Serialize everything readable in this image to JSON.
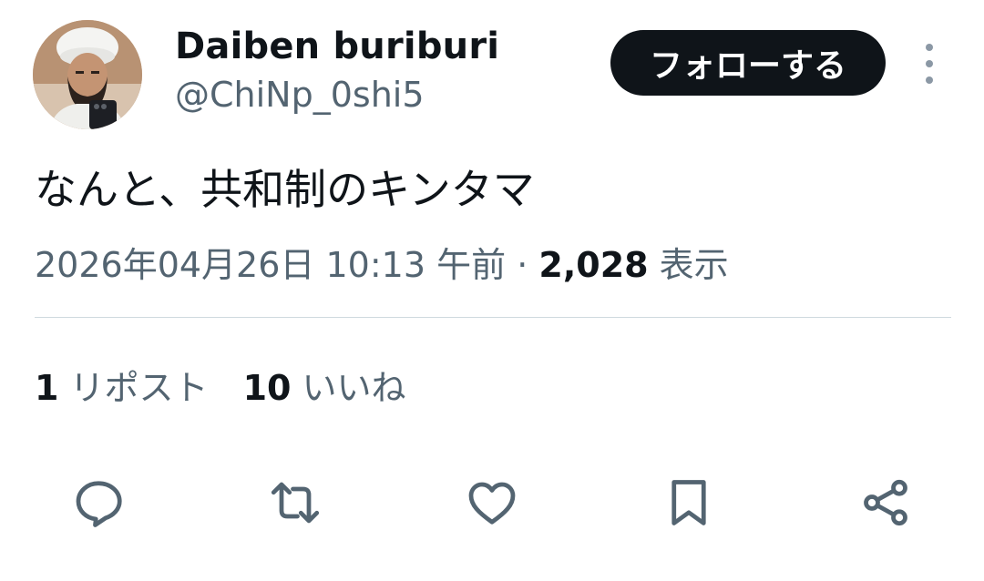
{
  "author": {
    "display_name": "Daiben buriburi",
    "handle": "@ChiNp_0shi5"
  },
  "follow_button": {
    "label": "フォローする"
  },
  "more_menu": {
    "icon": "more-vertical-icon"
  },
  "tweet": {
    "text": "なんと、共和制のキンタマ",
    "timestamp": "2026年04月26日 10:13 午前",
    "separator": "·",
    "view_count": "2,028",
    "view_label": "表示"
  },
  "stats": {
    "reposts_count": "1",
    "reposts_label": "リポスト",
    "likes_count": "10",
    "likes_label": "いいね"
  },
  "actions": [
    {
      "name": "reply",
      "icon": "reply-icon"
    },
    {
      "name": "repost",
      "icon": "repost-icon"
    },
    {
      "name": "like",
      "icon": "heart-icon"
    },
    {
      "name": "bookmark",
      "icon": "bookmark-icon"
    },
    {
      "name": "share",
      "icon": "share-icon"
    }
  ],
  "colors": {
    "text_primary": "#0f1419",
    "text_secondary": "#536471",
    "divider": "#cfd9de",
    "button_bg": "#0f1419",
    "button_text": "#ffffff"
  }
}
